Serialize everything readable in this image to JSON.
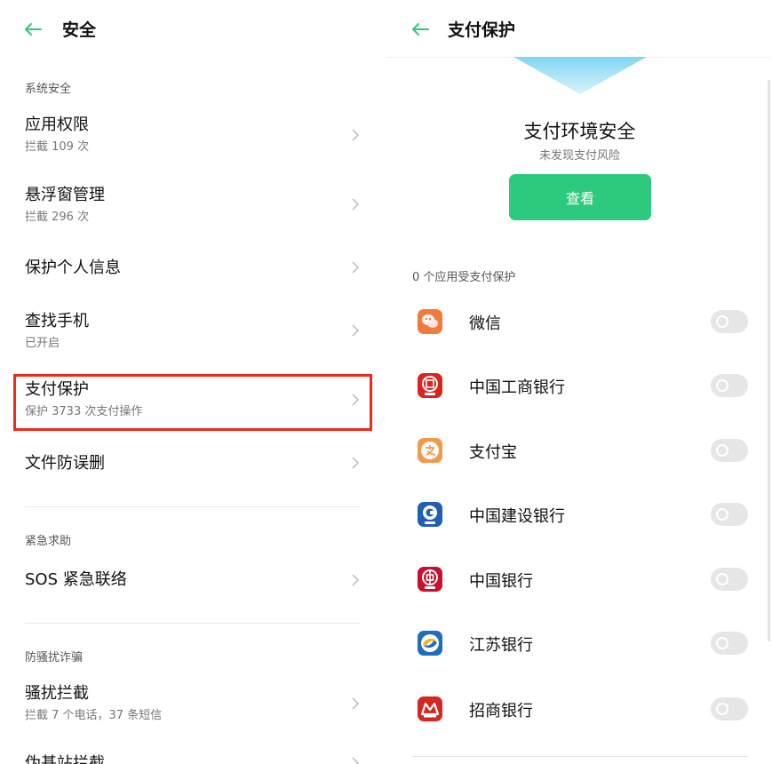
{
  "left": {
    "title": "安全",
    "sections": [
      {
        "header": "系统安全"
      },
      {
        "header": "紧急求助"
      },
      {
        "header": "防骚扰诈骗"
      }
    ],
    "items": [
      {
        "title": "应用权限",
        "subtitle": "拦截 109 次"
      },
      {
        "title": "悬浮窗管理",
        "subtitle": "拦截 296 次"
      },
      {
        "title": "保护个人信息",
        "subtitle": ""
      },
      {
        "title": "查找手机",
        "subtitle": "已开启"
      },
      {
        "title": "支付保护",
        "subtitle": "保护 3733 次支付操作"
      },
      {
        "title": "文件防误删",
        "subtitle": ""
      },
      {
        "title": "SOS 紧急联络",
        "subtitle": ""
      },
      {
        "title": "骚扰拦截",
        "subtitle": "拦截 7 个电话，37 条短信"
      },
      {
        "title": "伪基站拦截",
        "subtitle": ""
      }
    ]
  },
  "right": {
    "title": "支付保护",
    "env_title": "支付环境安全",
    "env_subtitle": "未发现支付风险",
    "view_button": "查看",
    "protected_count": "0 个应用受支付保护",
    "apps": [
      {
        "name": "微信",
        "icon": "wechat-icon",
        "enabled": false
      },
      {
        "name": "中国工商银行",
        "icon": "icbc-icon",
        "enabled": false
      },
      {
        "name": "支付宝",
        "icon": "alipay-icon",
        "enabled": false
      },
      {
        "name": "中国建设银行",
        "icon": "ccb-icon",
        "enabled": false
      },
      {
        "name": "中国银行",
        "icon": "boc-icon",
        "enabled": false
      },
      {
        "name": "江苏银行",
        "icon": "jsbank-icon",
        "enabled": false
      },
      {
        "name": "招商银行",
        "icon": "cmb-icon",
        "enabled": false
      }
    ]
  },
  "colors": {
    "accent": "#2dca7e",
    "highlight": "#ee2a1b"
  }
}
